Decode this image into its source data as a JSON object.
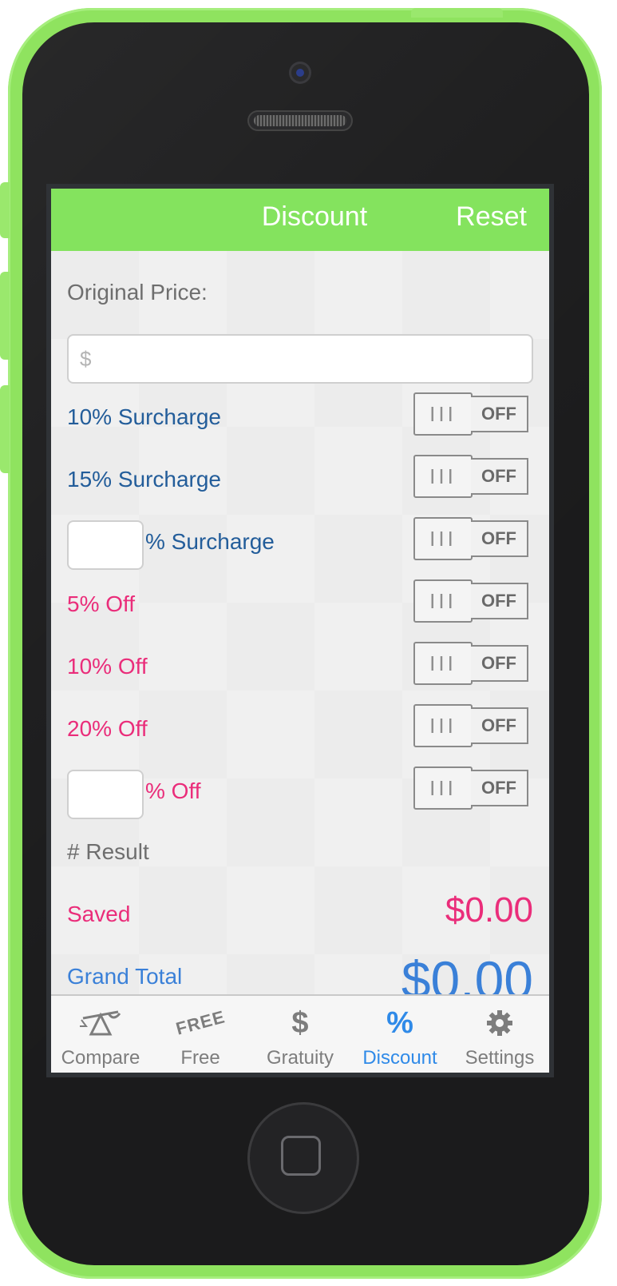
{
  "nav": {
    "title": "Discount",
    "reset": "Reset"
  },
  "form": {
    "original_price_label": "Original Price:",
    "price_placeholder": "$"
  },
  "rows": [
    {
      "label": "10% Surcharge",
      "state": "OFF"
    },
    {
      "label": "15% Surcharge",
      "state": "OFF"
    },
    {
      "label": "% Surcharge",
      "state": "OFF"
    },
    {
      "label": "5% Off",
      "state": "OFF"
    },
    {
      "label": "10% Off",
      "state": "OFF"
    },
    {
      "label": "20% Off",
      "state": "OFF"
    },
    {
      "label": "% Off",
      "state": "OFF"
    }
  ],
  "toggle_grip": "III",
  "result": {
    "header": "# Result",
    "saved_label": "Saved",
    "saved_value": "$0.00",
    "grand_total_label": "Grand Total",
    "grand_total_value": "$0.00"
  },
  "tabs": [
    {
      "label": "Compare",
      "icon": "scale-icon",
      "glyph": "⚖"
    },
    {
      "label": "Free",
      "icon": "free-icon",
      "glyph": "FREE"
    },
    {
      "label": "Gratuity",
      "icon": "dollar-icon",
      "glyph": "$"
    },
    {
      "label": "Discount",
      "icon": "percent-icon",
      "glyph": "%",
      "active": true
    },
    {
      "label": "Settings",
      "icon": "gear-icon",
      "glyph": "⚙"
    }
  ],
  "colors": {
    "accent_green": "#84e35e",
    "surcharge_blue": "#235d9a",
    "discount_pink": "#ea2d7a",
    "total_blue": "#3a80d8"
  }
}
